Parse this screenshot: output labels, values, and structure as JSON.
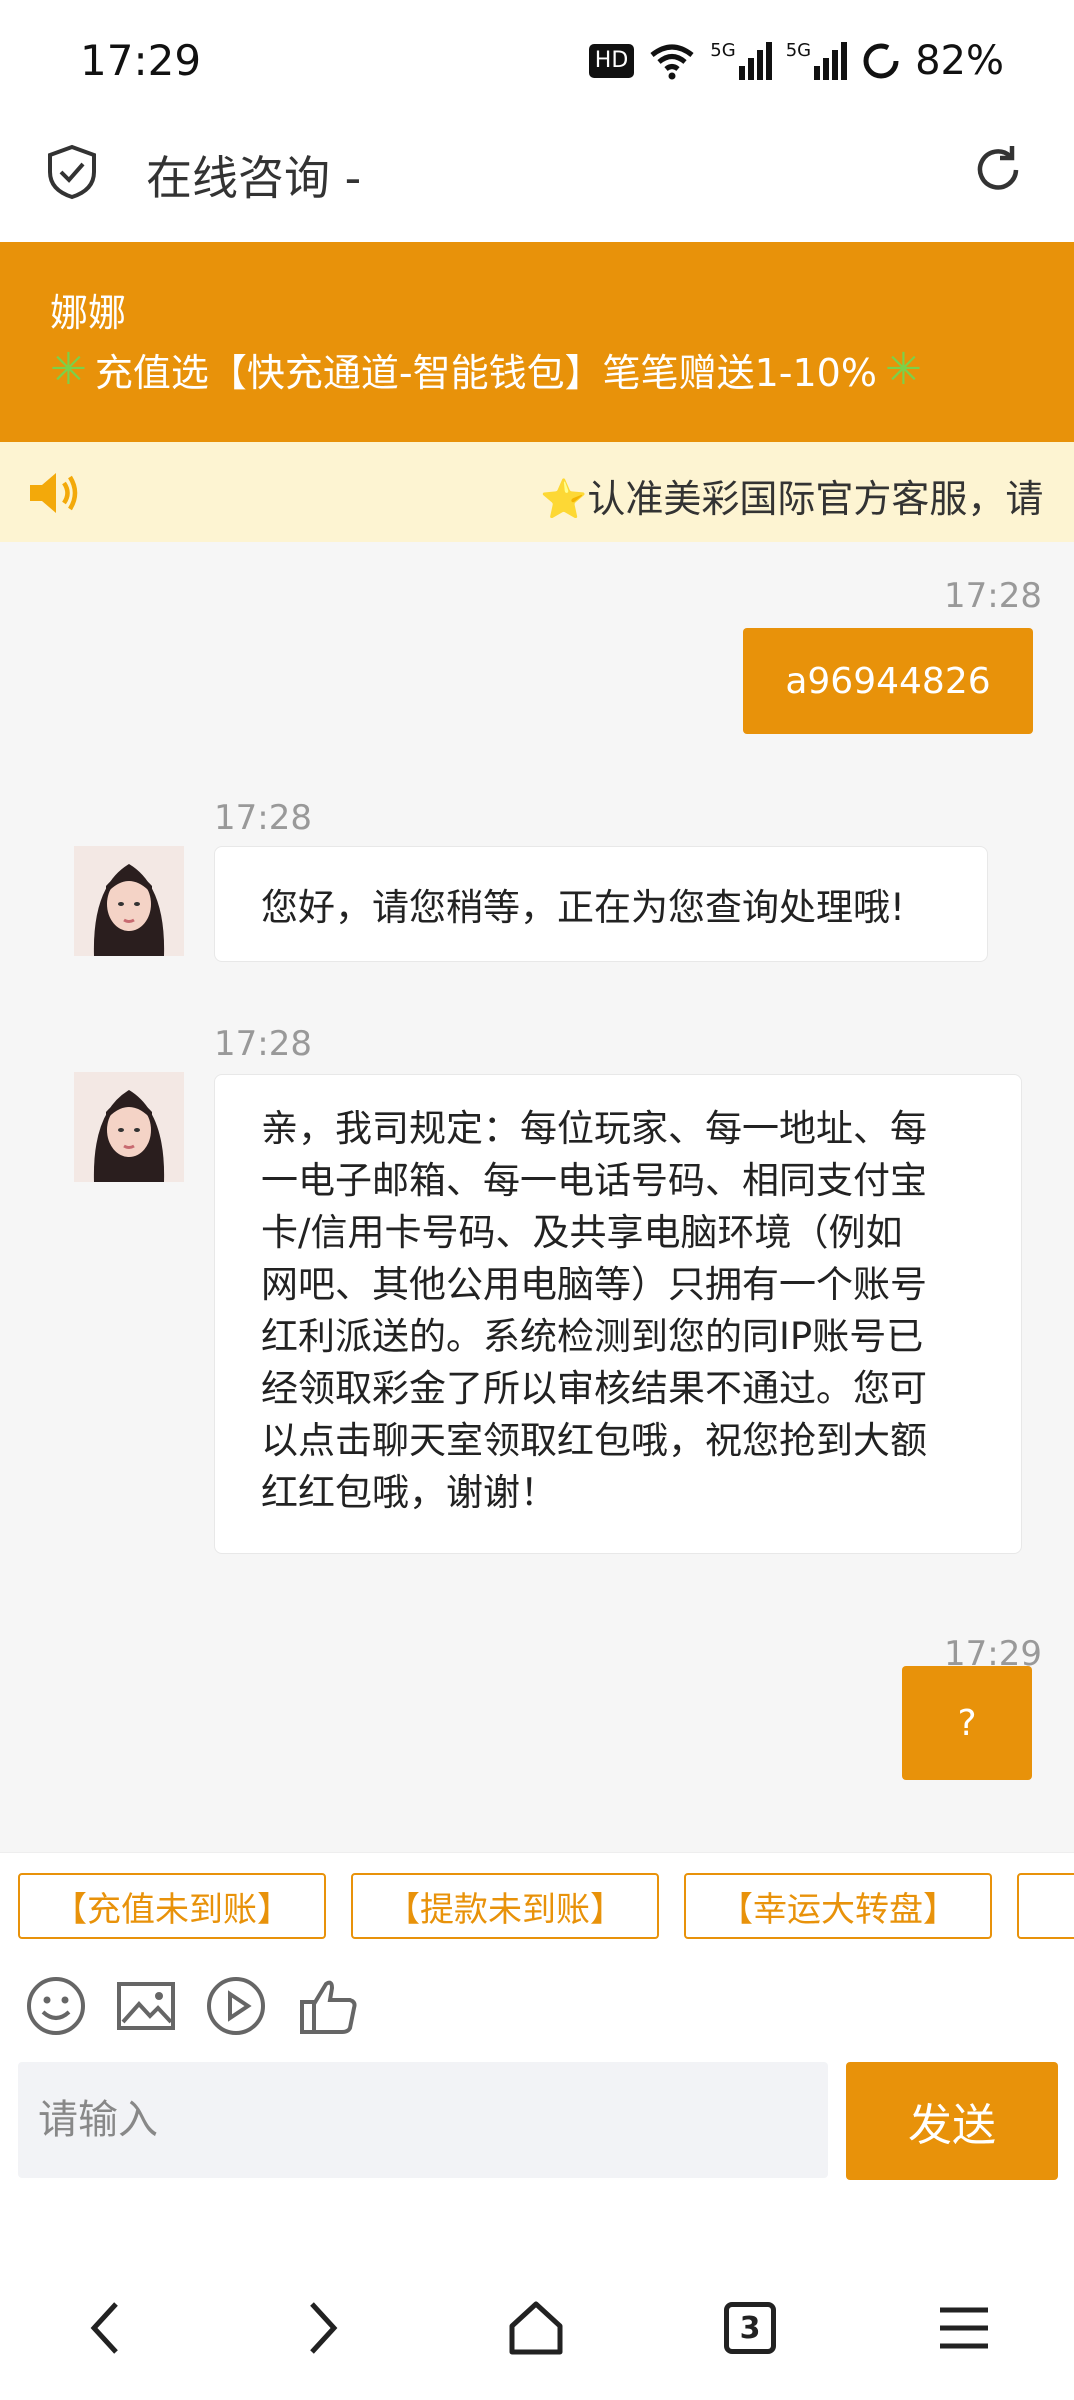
{
  "status_bar": {
    "time": "17:29",
    "network_badge": "HD",
    "signal_1": "5G",
    "signal_2": "5G",
    "battery": "82%"
  },
  "header": {
    "title": "在线咨询 -",
    "icons": [
      "shield-check-icon",
      "refresh-icon"
    ]
  },
  "banner": {
    "agent_name": "娜娜",
    "promo_text": "充值选【快充通道-智能钱包】笔笔赠送1-10%",
    "promo_prefix": "✳",
    "promo_suffix": "✳"
  },
  "notice": {
    "icon": "speaker-icon",
    "text": "⭐认准美彩国际官方客服，请"
  },
  "messages": [
    {
      "side": "out",
      "time": "17:28",
      "text": "a96944826"
    },
    {
      "side": "in",
      "time": "17:28",
      "text": "您好，请您稍等，正在为您查询处理哦!"
    },
    {
      "side": "in",
      "time": "17:28",
      "lines": [
        "亲，我司规定：每位玩家、每一地址、每",
        "一电子邮箱、每一电话号码、相同支付宝",
        "卡/信用卡号码、及共享电脑环境（例如",
        "网吧、其他公用电脑等）只拥有一个账号",
        "红利派送的。系统检测到您的同IP账号已",
        "经领取彩金了所以审核结果不通过。您可",
        "以点击聊天室领取红包哦，祝您抢到大额",
        "红红包哦，谢谢！"
      ]
    },
    {
      "side": "out",
      "time": "17:29",
      "text": "?"
    }
  ],
  "quick_replies": [
    "【充值未到账】",
    "【提款未到账】",
    "【幸运大转盘】"
  ],
  "tools": [
    "emoji-icon",
    "image-icon",
    "video-icon",
    "thumbs-up-icon"
  ],
  "input": {
    "placeholder": "请输入",
    "value": ""
  },
  "send_label": "发送",
  "nav": {
    "tab_count": "3"
  },
  "colors": {
    "accent": "#e8920a",
    "notice_bg": "#fdf4d2",
    "chat_bg": "#f6f6f6"
  }
}
